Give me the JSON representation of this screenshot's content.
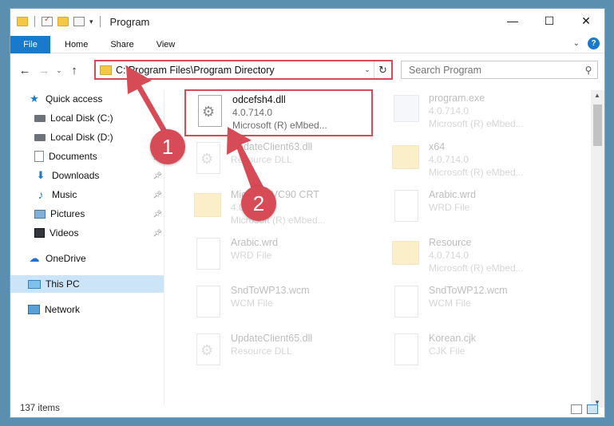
{
  "titlebar": {
    "title": "Program",
    "window_buttons": [
      "—",
      "☐",
      "✕"
    ]
  },
  "ribbon": {
    "tabs": [
      "File",
      "Home",
      "Share",
      "View"
    ]
  },
  "address": {
    "path": "C:\\Program Files\\Program Directory"
  },
  "search": {
    "placeholder": "Search Program"
  },
  "sidebar": {
    "items": [
      {
        "label": "Quick access",
        "icon": "star-icon"
      },
      {
        "label": "Local Disk (C:)",
        "icon": "disk-icon"
      },
      {
        "label": "Local Disk (D:)",
        "icon": "disk-icon"
      },
      {
        "label": "Documents",
        "icon": "documents-icon",
        "pinned": true
      },
      {
        "label": "Downloads",
        "icon": "downloads-icon",
        "pinned": true
      },
      {
        "label": "Music",
        "icon": "music-icon",
        "pinned": true
      },
      {
        "label": "Pictures",
        "icon": "pictures-icon",
        "pinned": true
      },
      {
        "label": "Videos",
        "icon": "videos-icon",
        "pinned": true
      },
      {
        "label": "OneDrive",
        "icon": "onedrive-icon"
      },
      {
        "label": "This PC",
        "icon": "pc-icon",
        "selected": true
      },
      {
        "label": "Network",
        "icon": "network-icon"
      }
    ]
  },
  "files": [
    {
      "name": "odcefsh4.dll",
      "line2": "4.0.714.0",
      "line3": "Microsoft (R) eMbed...",
      "type": "dll",
      "highlighted": true
    },
    {
      "name": "program.exe",
      "line2": "4.0.714.0",
      "line3": "Microsoft (R) eMbed...",
      "type": "exe"
    },
    {
      "name": "UpdateClient63.dll",
      "line2": "Resource DLL",
      "line3": "",
      "type": "dll"
    },
    {
      "name": "x64",
      "line2": "4.0.714.0",
      "line3": "Microsoft (R) eMbed...",
      "type": "folder"
    },
    {
      "name": "MicrosoftVC90 CRT",
      "line2": "4.0.714.0",
      "line3": "Microsoft (R) eMbed...",
      "type": "folder"
    },
    {
      "name": "Arabic.wrd",
      "line2": "WRD File",
      "line3": "",
      "type": "file"
    },
    {
      "name": "Arabic.wrd",
      "line2": "WRD File",
      "line3": "",
      "type": "file"
    },
    {
      "name": "Resource",
      "line2": "4.0.714.0",
      "line3": "Microsoft (R) eMbed...",
      "type": "folder"
    },
    {
      "name": "SndToWP13.wcm",
      "line2": "WCM File",
      "line3": "",
      "type": "file"
    },
    {
      "name": "SndToWP12.wcm",
      "line2": "WCM File",
      "line3": "",
      "type": "file"
    },
    {
      "name": "UpdateClient65.dll",
      "line2": "Resource DLL",
      "line3": "",
      "type": "dll"
    },
    {
      "name": "Korean.cjk",
      "line2": "CJK File",
      "line3": "",
      "type": "file"
    }
  ],
  "status": {
    "items_count": "137 items"
  },
  "annotations": {
    "step1": "1",
    "step2": "2",
    "color": "#d64b56"
  }
}
